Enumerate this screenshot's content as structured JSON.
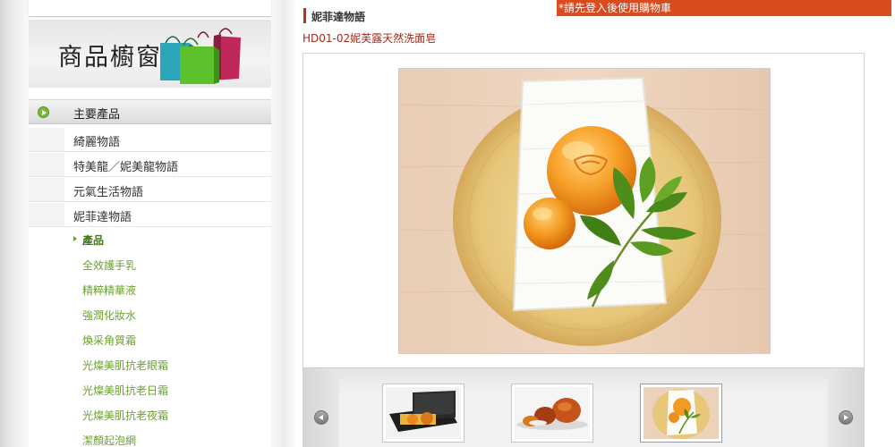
{
  "sidebar": {
    "banner_title": "商品櫥窗",
    "section_label": "主要產品",
    "categories": [
      {
        "label": "綺麗物語"
      },
      {
        "label": "特美龍／妮美龍物語"
      },
      {
        "label": "元氣生活物語"
      },
      {
        "label": "妮菲達物語"
      }
    ],
    "subitems": [
      {
        "label": "產品",
        "active": true
      },
      {
        "label": "全效護手乳"
      },
      {
        "label": "精粹精華液"
      },
      {
        "label": "強潤化妝水"
      },
      {
        "label": "煥采角質霜"
      },
      {
        "label": "光燦美肌抗老眼霜"
      },
      {
        "label": "光燦美肌抗老日霜"
      },
      {
        "label": "光燦美肌抗老夜霜"
      },
      {
        "label": "潔顏起泡網"
      }
    ]
  },
  "header": {
    "login_notice": "*請先登入後使用購物車",
    "heading": "妮菲達物語",
    "product_name": "HD01-02妮芙露天然洗面皂"
  },
  "colors": {
    "accent_red": "#b5341c",
    "notice_bg": "#d94a1e",
    "link_green": "#6aa22c",
    "product_name_red": "#a3281b"
  }
}
